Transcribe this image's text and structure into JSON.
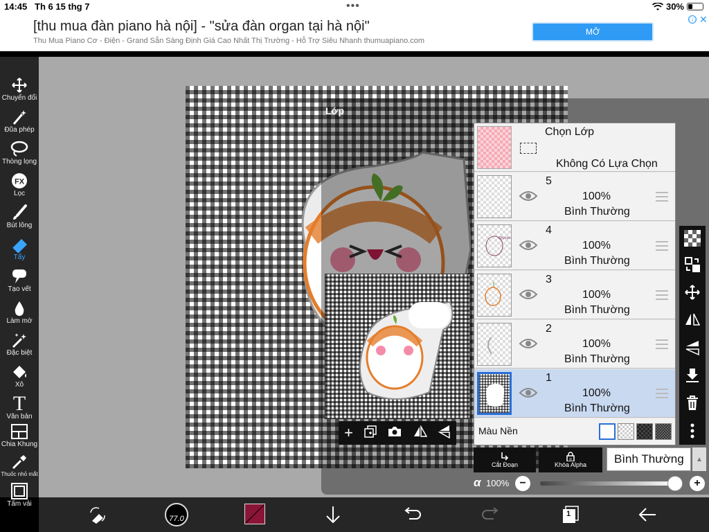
{
  "status_bar": {
    "time": "14:45",
    "date": "Th 6 15 thg 7",
    "battery": "30%",
    "battery_level": 0.3
  },
  "ad": {
    "title": "[thu mua đàn piano hà nội] - \"sửa đàn organ tại hà nội\"",
    "subtitle": "Thu Mua Piano Cơ - Điện - Grand Sẵn Sàng Định Giá Cao Nhất Thị Trường - Hỗ Trợ Siêu Nhanh thumuapiano.com",
    "open_label": "MỞ",
    "info_icon": "ⓘ",
    "close_icon": "✕"
  },
  "tools": [
    {
      "label": "Chuyển đổi",
      "icon": "move-icon"
    },
    {
      "label": "Đũa phép",
      "icon": "magic-wand-icon"
    },
    {
      "label": "Thòng lọng",
      "icon": "lasso-icon"
    },
    {
      "label": "Lọc",
      "icon": "fx-icon"
    },
    {
      "label": "Bút lông",
      "icon": "brush-icon"
    },
    {
      "label": "Tẩy",
      "icon": "eraser-icon",
      "active": true
    },
    {
      "label": "Tạo vết",
      "icon": "smudge-icon"
    },
    {
      "label": "Làm mờ",
      "icon": "blur-icon"
    },
    {
      "label": "Đặc biệt",
      "icon": "special-icon"
    },
    {
      "label": "Xô",
      "icon": "bucket-icon"
    },
    {
      "label": "Văn bản",
      "icon": "text-icon"
    },
    {
      "label": "Chia Khung",
      "icon": "frame-divider-icon"
    },
    {
      "label": "Thuốc nhỏ mắt",
      "icon": "eyedropper-icon"
    },
    {
      "label": "Tấm vải",
      "icon": "canvas-icon"
    }
  ],
  "layers_panel": {
    "title": "Lớp",
    "selection": {
      "title": "Chọn Lớp",
      "status": "Không Có Lựa Chọn"
    },
    "layers": [
      {
        "number": "5",
        "opacity": "100%",
        "mode": "Bình Thường"
      },
      {
        "number": "4",
        "opacity": "100%",
        "mode": "Bình Thường"
      },
      {
        "number": "3",
        "opacity": "100%",
        "mode": "Bình Thường"
      },
      {
        "number": "2",
        "opacity": "100%",
        "mode": "Bình Thường"
      },
      {
        "number": "1",
        "opacity": "100%",
        "mode": "Bình Thường",
        "selected": true
      }
    ],
    "background_label": "Màu Nền",
    "clipping_label": "Cắt Đoạn",
    "alpha_lock_label": "Khóa Alpha",
    "blend_mode": "Bình Thường",
    "alpha_symbol": "α",
    "alpha_value": "100%",
    "alpha_level": 1.0
  },
  "bottom_bar": {
    "brush_size": "77.0",
    "color": "#8b1538",
    "pages_count": "1"
  },
  "colors": {
    "accent": "#3aa5ff",
    "ad_button": "#2f9bf5",
    "selected_layer": "#c9d9f0"
  }
}
